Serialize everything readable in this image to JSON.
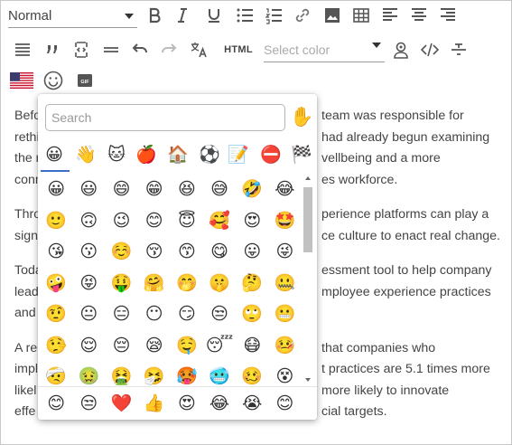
{
  "toolbar": {
    "paragraph_format": "Normal",
    "html_label": "HTML",
    "color_placeholder": "Select color"
  },
  "content": {
    "paragraphs": [
      [
        "Befo",
        "team was responsible for"
      ],
      [
        "rethi",
        "had already begun examining"
      ],
      [
        "the r",
        "vellbeing and a more"
      ],
      [
        "conn",
        "es workforce."
      ],
      [
        "Thro",
        "perience platforms can play a"
      ],
      [
        "sign",
        "ce culture to enact real change."
      ],
      [
        "Toda",
        "essment tool to help company"
      ],
      [
        "lead",
        "mployee experience practices"
      ],
      [
        "and",
        ""
      ],
      [
        "A re",
        "that companies who"
      ],
      [
        "impl",
        "t practices are 5.1 times more"
      ],
      [
        "likel",
        "more likely to innovate"
      ],
      [
        "effe",
        "cial targets."
      ]
    ]
  },
  "emoji_picker": {
    "search_placeholder": "Search",
    "skin_tone": "✋",
    "categories": [
      "😀",
      "👋",
      "🐱",
      "🍎",
      "🏠",
      "⚽",
      "📝",
      "⛔",
      "🏁"
    ],
    "emojis": [
      "😀",
      "😃",
      "😄",
      "😁",
      "😆",
      "😅",
      "🤣",
      "😂",
      "🙂",
      "🙃",
      "😉",
      "😊",
      "😇",
      "🥰",
      "😍",
      "🤩",
      "😘",
      "😗",
      "☺️",
      "😚",
      "😙",
      "😋",
      "😛",
      "😜",
      "🤪",
      "😝",
      "🤑",
      "🤗",
      "🤭",
      "🤫",
      "🤔",
      "🤐",
      "🤨",
      "😐",
      "😑",
      "😶",
      "😏",
      "😒",
      "🙄",
      "😬",
      "🤥",
      "😌",
      "😔",
      "😪",
      "🤤",
      "😴",
      "😷",
      "🤒",
      "🤕",
      "🤢",
      "🤮",
      "🤧",
      "🥵",
      "🥶",
      "🥴",
      "😵"
    ],
    "recent": [
      "😊",
      "😒",
      "❤️",
      "👍",
      "😍",
      "😂",
      "😭",
      "😊"
    ]
  }
}
